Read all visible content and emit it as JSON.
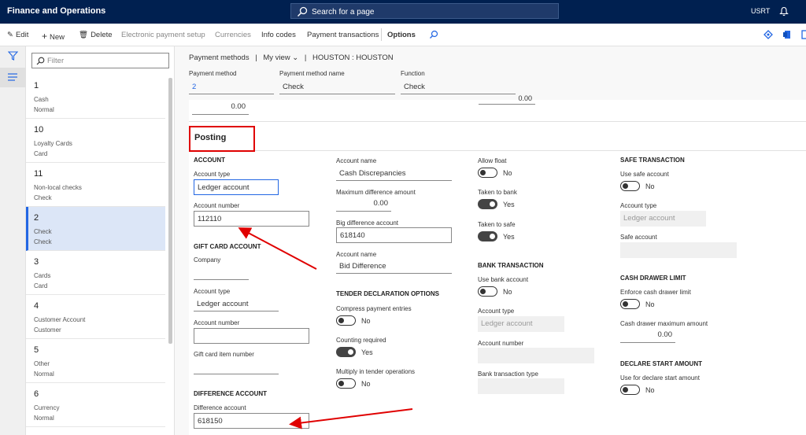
{
  "app": {
    "title": "Finance and Operations",
    "search": "Search for a page",
    "user": "USRT"
  },
  "toolbar": {
    "edit": "Edit",
    "new": "New",
    "delete": "Delete",
    "electronic": "Electronic payment setup",
    "currencies": "Currencies",
    "info_codes": "Info codes",
    "payment_transactions": "Payment transactions",
    "options": "Options"
  },
  "list": {
    "filter_placeholder": "Filter",
    "items": [
      {
        "t1": "1",
        "t2": "Cash",
        "t3": "Normal"
      },
      {
        "t1": "10",
        "t2": "Loyalty Cards",
        "t3": "Card"
      },
      {
        "t1": "11",
        "t2": "Non-local checks",
        "t3": "Check"
      },
      {
        "t1": "2",
        "t2": "Check",
        "t3": "Check"
      },
      {
        "t1": "3",
        "t2": "Cards",
        "t3": "Card"
      },
      {
        "t1": "4",
        "t2": "Customer Account",
        "t3": "Customer"
      },
      {
        "t1": "5",
        "t2": "Other",
        "t3": "Normal"
      },
      {
        "t1": "6",
        "t2": "Currency",
        "t3": "Normal"
      }
    ]
  },
  "breadcrumb": {
    "part1": "Payment methods",
    "sep": "|",
    "view": "My view",
    "sep2": "|",
    "part2": "HOUSTON : HOUSTON"
  },
  "header": {
    "payment_method_label": "Payment method",
    "payment_method": "2",
    "name_label": "Payment method name",
    "name": "Check",
    "function_label": "Function",
    "function": "Check"
  },
  "prev": {
    "value1": "0.00",
    "value2": "0.00"
  },
  "posting": {
    "title": "Posting",
    "account": {
      "heading": "ACCOUNT",
      "type_label": "Account type",
      "type": "Ledger account",
      "number_label": "Account number",
      "number": "112110"
    },
    "gift": {
      "heading": "GIFT CARD ACCOUNT",
      "company_label": "Company",
      "company": "",
      "type_label": "Account type",
      "type": "Ledger account",
      "number_label": "Account number",
      "number": "",
      "item_label": "Gift card item number",
      "item": ""
    },
    "difference": {
      "heading": "DIFFERENCE ACCOUNT",
      "label": "Difference account",
      "value": "618150"
    },
    "col2": {
      "account_name_label": "Account name",
      "account_name": "Cash Discrepancies",
      "max_diff_label": "Maximum difference amount",
      "max_diff": "0.00",
      "big_diff_label": "Big difference account",
      "big_diff": "618140",
      "account_name2_label": "Account name",
      "account_name2": "Bid Difference",
      "tender_heading": "TENDER DECLARATION OPTIONS",
      "compress_label": "Compress payment entries",
      "compress": "No",
      "counting_label": "Counting required",
      "counting": "Yes",
      "multiply_label": "Multiply in tender operations",
      "multiply": "No"
    },
    "col3": {
      "allow_float_label": "Allow float",
      "allow_float": "No",
      "taken_bank_label": "Taken to bank",
      "taken_bank": "Yes",
      "taken_safe_label": "Taken to safe",
      "taken_safe": "Yes",
      "bank_heading": "BANK TRANSACTION",
      "use_bank_label": "Use bank account",
      "use_bank": "No",
      "acct_type_label": "Account type",
      "acct_type": "Ledger account",
      "acct_number_label": "Account number",
      "acct_number": "",
      "bank_tx_type_label": "Bank transaction type",
      "bank_tx_type": ""
    },
    "col4": {
      "safe_heading": "SAFE TRANSACTION",
      "use_safe_label": "Use safe account",
      "use_safe": "No",
      "acct_type_label": "Account type",
      "acct_type": "Ledger account",
      "safe_account_label": "Safe account",
      "safe_account": "",
      "drawer_heading": "CASH DRAWER LIMIT",
      "enforce_label": "Enforce cash drawer limit",
      "enforce": "No",
      "max_amount_label": "Cash drawer maximum amount",
      "max_amount": "0.00",
      "declare_heading": "DECLARE START AMOUNT",
      "declare_label": "Use for declare start amount",
      "declare": "No"
    }
  },
  "colors": {
    "nav": "#002050",
    "accent": "#2266e3",
    "annotation": "#e00000"
  }
}
